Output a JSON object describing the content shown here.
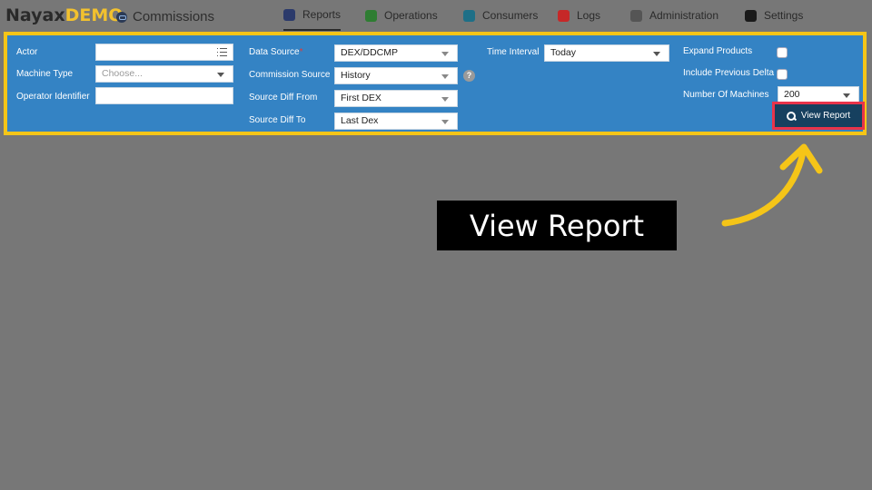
{
  "app": {
    "brand": "Nayax",
    "brand_suffix": "DEMO",
    "module_title": "Commissions"
  },
  "nav": {
    "items": [
      {
        "label": "Reports",
        "icon": "reports-icon",
        "color": "#2b3a6b",
        "active": true
      },
      {
        "label": "Operations",
        "icon": "operations-icon",
        "color": "#2e7d32",
        "active": false
      },
      {
        "label": "Consumers",
        "icon": "consumers-icon",
        "color": "#1e6f87",
        "active": false
      },
      {
        "label": "Logs",
        "icon": "logs-icon",
        "color": "#c62828",
        "active": false
      },
      {
        "label": "Administration",
        "icon": "administration-icon",
        "color": "#555555",
        "active": false
      },
      {
        "label": "Settings",
        "icon": "settings-icon",
        "color": "#1a1a1a",
        "active": false
      }
    ]
  },
  "filters": {
    "actor": {
      "label": "Actor",
      "value": ""
    },
    "machine_type": {
      "label": "Machine Type",
      "placeholder": "Choose..."
    },
    "operator_identifier": {
      "label": "Operator Identifier",
      "value": ""
    },
    "data_source": {
      "label": "Data Source",
      "required_mark": "*",
      "value": "DEX/DDCMP"
    },
    "commission_source": {
      "label": "Commission Source",
      "value": "History"
    },
    "source_diff_from": {
      "label": "Source Diff From",
      "value": "First DEX"
    },
    "source_diff_to": {
      "label": "Source Diff To",
      "value": "Last Dex"
    },
    "time_interval": {
      "label": "Time Interval",
      "value": "Today"
    },
    "expand_products": {
      "label": "Expand Products",
      "checked": false
    },
    "include_previous_delta": {
      "label": "Include Previous Delta",
      "checked": false
    },
    "number_of_machines": {
      "label": "Number Of Machines",
      "value": "200"
    },
    "help_glyph": "?"
  },
  "actions": {
    "view_report_label": "View Report"
  },
  "callout": {
    "text": "View Report"
  },
  "colors": {
    "panel": "#3483c4",
    "highlight_border": "#f5c518",
    "button": "#16405f",
    "button_outline": "#e8344a",
    "arrow": "#f5c518"
  }
}
